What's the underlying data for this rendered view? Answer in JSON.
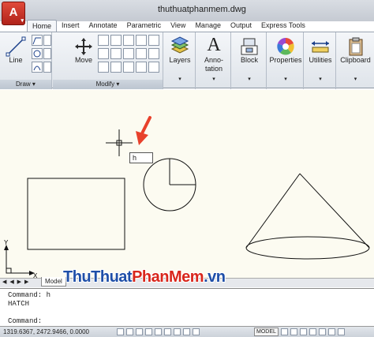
{
  "window": {
    "title": "thuthuatphanmem.dwg"
  },
  "app_button": {
    "label": "A"
  },
  "tabs": [
    {
      "label": "Home"
    },
    {
      "label": "Insert"
    },
    {
      "label": "Annotate"
    },
    {
      "label": "Parametric"
    },
    {
      "label": "View"
    },
    {
      "label": "Manage"
    },
    {
      "label": "Output"
    },
    {
      "label": "Express Tools"
    }
  ],
  "active_tab": "Home",
  "ribbon": {
    "draw": {
      "title": "Draw",
      "line_label": "Line"
    },
    "modify": {
      "title": "Modify",
      "move_label": "Move"
    },
    "layers_label": "Layers",
    "annotation": {
      "label": "Anno-tation",
      "line1": "Anno-",
      "line2": "tation",
      "glyph": "A"
    },
    "block_label": "Block",
    "properties_label": "Properties",
    "utilities_label": "Utilities",
    "clipboard_label": "Clipboard"
  },
  "canvas": {
    "inline_input": "h",
    "ucs_y": "Y",
    "ucs_x": "X",
    "accent_color": "#e8412c"
  },
  "layout": {
    "model_tab": "Model"
  },
  "command": {
    "history": [
      "Command: h",
      "HATCH"
    ],
    "prompt": "Command:"
  },
  "status": {
    "coordinates": "1319.6367, 2472.9466, 0.0000",
    "model": "MODEL"
  },
  "watermark": {
    "part1": "ThuThuat",
    "part2": "PhanMem",
    "part3": ".vn"
  }
}
